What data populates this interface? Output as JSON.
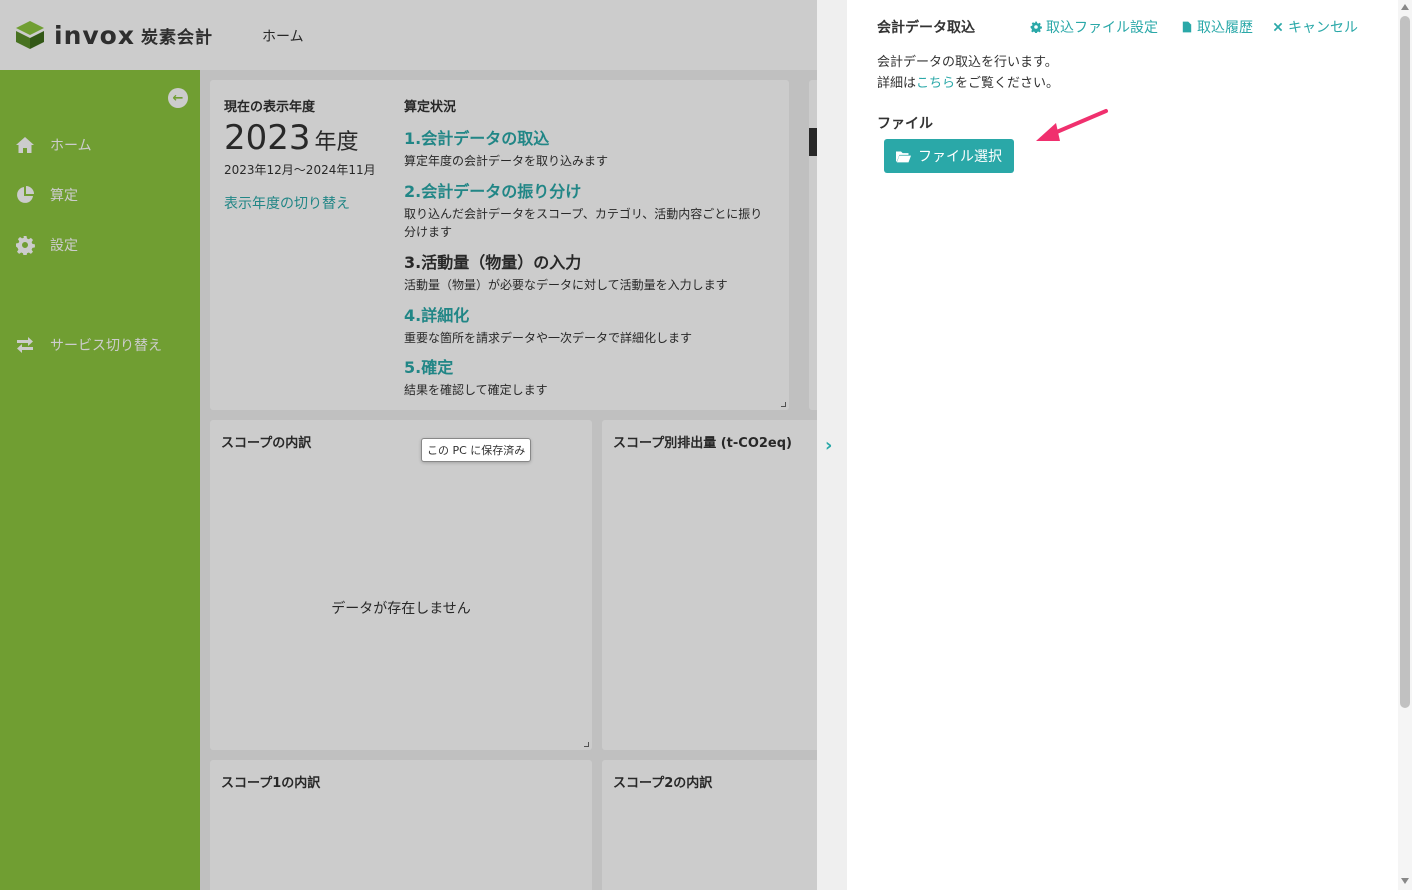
{
  "header": {
    "logo_word": "invox",
    "logo_sub": "炭素会計",
    "breadcrumb": "ホーム"
  },
  "sidebar": {
    "items": [
      {
        "label": "ホーム",
        "icon": "home-icon"
      },
      {
        "label": "算定",
        "icon": "pie-chart-icon"
      },
      {
        "label": "設定",
        "icon": "gear-icon"
      },
      {
        "label": "サービス切り替え",
        "icon": "switch-icon"
      }
    ]
  },
  "year_card": {
    "label": "現在の表示年度",
    "year": "2023",
    "year_unit": "年度",
    "range": "2023年12月〜2024年11月",
    "switch_link": "表示年度の切り替え"
  },
  "status": {
    "title": "算定状況",
    "steps": [
      {
        "title": "1.会計データの取込",
        "desc": "算定年度の会計データを取り込みます"
      },
      {
        "title": "2.会計データの振り分け",
        "desc": "取り込んだ会計データをスコープ、カテゴリ、活動内容ごとに振り分けます"
      },
      {
        "title": "3.活動量（物量）の入力",
        "desc": "活動量（物量）が必要なデータに対して活動量を入力します"
      },
      {
        "title": "4.詳細化",
        "desc": "重要な箇所を請求データや一次データで詳細化します"
      },
      {
        "title": "5.確定",
        "desc": "結果を確認して確定します"
      }
    ]
  },
  "panels": {
    "scope_breakdown": {
      "title": "スコープの内訳",
      "empty": "データが存在しません"
    },
    "scope_emissions": {
      "title": "スコープ別排出量 (t-CO2eq)"
    },
    "scope1": {
      "title": "スコープ1の内訳"
    },
    "scope2": {
      "title": "スコープ2の内訳"
    }
  },
  "tooltip": "この PC に保存済み",
  "drawer": {
    "title": "会計データ取込",
    "actions": [
      {
        "label": "取込ファイル設定",
        "icon": "gear-icon"
      },
      {
        "label": "取込履歴",
        "icon": "file-icon"
      },
      {
        "label": "キャンセル",
        "icon": "close-icon"
      }
    ],
    "desc_line1": "会計データの取込を行います。",
    "desc_line2_pre": "詳細は",
    "desc_line2_link": "こちら",
    "desc_line2_post": "をご覧ください。",
    "file_label": "ファイル",
    "file_button": "ファイル選択"
  },
  "colors": {
    "sidebar": "#8cc63f",
    "accent": "#2aa8a8",
    "arrow": "#f0306e"
  }
}
